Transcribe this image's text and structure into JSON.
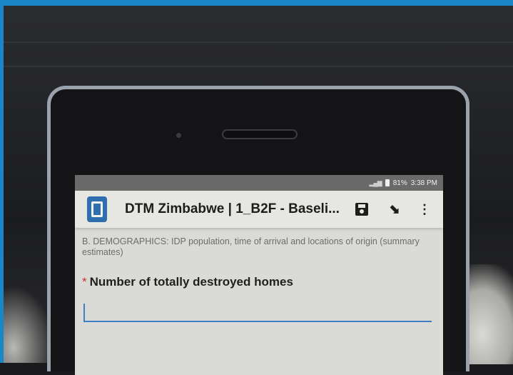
{
  "status_bar": {
    "battery": "81%",
    "time": "3:38 PM"
  },
  "toolbar": {
    "app_icon": "collect-app-icon",
    "title": "DTM Zimbabwe | 1_B2F - Baseli...",
    "save_icon": "save-icon",
    "send_icon": "send-icon",
    "menu_icon": "more-vert-icon"
  },
  "form": {
    "section": "B. DEMOGRAPHICS: IDP population, time of arrival and locations of origin (summary estimates)",
    "required_marker": "*",
    "question": "Number of totally destroyed homes",
    "answer_value": ""
  },
  "colors": {
    "frame": "#1a86c8",
    "accent": "#3d7fc2",
    "app_icon": "#2f6fae",
    "required": "#c0392b"
  }
}
